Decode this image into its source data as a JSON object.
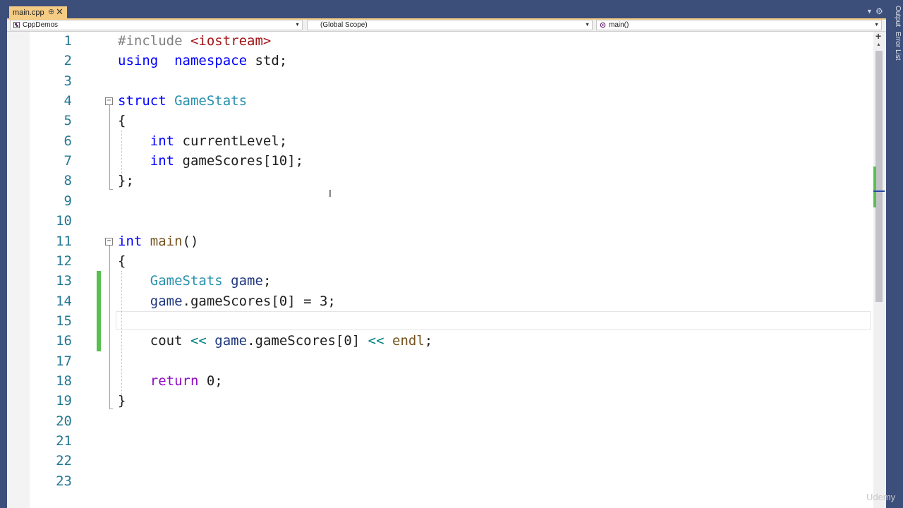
{
  "tab": {
    "filename": "main.cpp",
    "pin_glyph": "⊕",
    "close_glyph": "✕"
  },
  "navbar": {
    "project": "CppDemos",
    "scope": "(Global Scope)",
    "member": "main()"
  },
  "side_panels": [
    "Output",
    "Error List"
  ],
  "editor": {
    "lines": [
      {
        "n": "1",
        "tokens": [
          [
            "pp",
            "#include "
          ],
          [
            "str",
            "<iostream>"
          ]
        ]
      },
      {
        "n": "2",
        "tokens": [
          [
            "kw",
            "using"
          ],
          [
            "",
            "  "
          ],
          [
            "kw",
            "namespace"
          ],
          [
            "",
            " std;"
          ]
        ]
      },
      {
        "n": "3",
        "tokens": []
      },
      {
        "n": "4",
        "tokens": [
          [
            "kw",
            "struct"
          ],
          [
            "",
            " "
          ],
          [
            "type",
            "GameStats"
          ]
        ]
      },
      {
        "n": "5",
        "tokens": [
          [
            "",
            "{"
          ]
        ]
      },
      {
        "n": "6",
        "tokens": [
          [
            "",
            "    "
          ],
          [
            "kw",
            "int"
          ],
          [
            "",
            " currentLevel;"
          ]
        ]
      },
      {
        "n": "7",
        "tokens": [
          [
            "",
            "    "
          ],
          [
            "kw",
            "int"
          ],
          [
            "",
            " gameScores[10];"
          ]
        ]
      },
      {
        "n": "8",
        "tokens": [
          [
            "",
            "};"
          ]
        ]
      },
      {
        "n": "9",
        "tokens": []
      },
      {
        "n": "10",
        "tokens": []
      },
      {
        "n": "11",
        "tokens": [
          [
            "kw",
            "int"
          ],
          [
            "",
            " "
          ],
          [
            "fn",
            "main"
          ],
          [
            "",
            "()"
          ]
        ]
      },
      {
        "n": "12",
        "tokens": [
          [
            "",
            "{"
          ]
        ]
      },
      {
        "n": "13",
        "tokens": [
          [
            "",
            "    "
          ],
          [
            "type",
            "GameStats"
          ],
          [
            "",
            " "
          ],
          [
            "var",
            "game"
          ],
          [
            "",
            ";"
          ]
        ]
      },
      {
        "n": "14",
        "tokens": [
          [
            "",
            "    "
          ],
          [
            "var",
            "game"
          ],
          [
            "",
            ".gameScores[0] = 3;"
          ]
        ]
      },
      {
        "n": "15",
        "tokens": []
      },
      {
        "n": "16",
        "tokens": [
          [
            "",
            "    cout "
          ],
          [
            "op",
            "<<"
          ],
          [
            "",
            " "
          ],
          [
            "var",
            "game"
          ],
          [
            "",
            ".gameScores[0] "
          ],
          [
            "op",
            "<<"
          ],
          [
            "",
            " "
          ],
          [
            "fn",
            "endl"
          ],
          [
            "",
            ";"
          ]
        ]
      },
      {
        "n": "17",
        "tokens": []
      },
      {
        "n": "18",
        "tokens": [
          [
            "",
            "    "
          ],
          [
            "ctl",
            "return"
          ],
          [
            "",
            " 0;"
          ]
        ]
      },
      {
        "n": "19",
        "tokens": [
          [
            "",
            "}"
          ]
        ]
      },
      {
        "n": "20",
        "tokens": []
      },
      {
        "n": "21",
        "tokens": []
      },
      {
        "n": "22",
        "tokens": []
      },
      {
        "n": "23",
        "tokens": []
      }
    ]
  },
  "watermark": "Udemy",
  "colors": {
    "frame": "#3c4f7a",
    "tab_active": "#f5cc84",
    "line_number": "#237893",
    "change_bar": "#57c04f"
  }
}
